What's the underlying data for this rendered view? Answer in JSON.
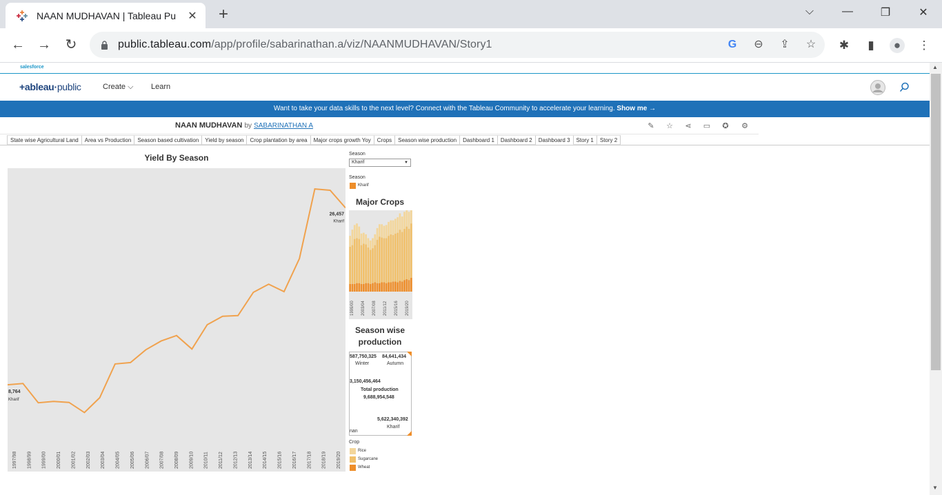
{
  "browser": {
    "tab_title": "NAAN MUDHAVAN | Tableau Pu",
    "url_host": "public.tableau.com",
    "url_path": "/app/profile/sabarinathan.a/viz/NAANMUDHAVAN/Story1"
  },
  "salesforce": {
    "label": "salesforce"
  },
  "site": {
    "logo_main": "+ableau",
    "logo_sub": "public",
    "nav_create": "Create ⌵",
    "nav_learn": "Learn"
  },
  "banner": {
    "text": "Want to take your data skills to the next level? Connect with the Tableau Community to accelerate your learning.",
    "link": "Show me →"
  },
  "viz": {
    "title": "NAAN MUDHAVAN",
    "by": "by",
    "author": "SABARINATHAN A",
    "tabs": [
      "State wise Agricultural Land",
      "Area vs Production",
      "Season based cultivation",
      "Yield by season",
      "Crop plantation by area",
      "Major crops growth Yoy",
      "Crops",
      "Season wise production",
      "Dashboard 1",
      "Dashboard 2",
      "Dashboard 3",
      "Story 1",
      "Story 2"
    ],
    "active_tab": "Dashboard 3"
  },
  "filters": {
    "season_label": "Season",
    "season_value": "Kharif",
    "legend_label": "Season",
    "legend_item": "Kharif",
    "crop_label": "Crop",
    "crop_items": [
      "Rice",
      "Sugarcane",
      "Wheat"
    ],
    "crop_colors": [
      "#f3d69b",
      "#f1c06a",
      "#ee8e2a"
    ]
  },
  "chart_data": [
    {
      "type": "line",
      "title": "Yield By Season",
      "color": "#f0a24e",
      "x": [
        "1997/98",
        "1998/99",
        "1999/00",
        "2000/01",
        "2001/02",
        "2002/03",
        "2003/04",
        "2004/05",
        "2005/06",
        "2006/07",
        "2007/08",
        "2008/09",
        "2009/10",
        "2010/11",
        "2011/12",
        "2012/13",
        "2013/14",
        "2014/15",
        "2015/16",
        "2016/17",
        "2017/18",
        "2018/19",
        "2019/20"
      ],
      "series": [
        {
          "values": [
            8764,
            8950,
            6100,
            6300,
            6150,
            4650,
            6850,
            11850,
            12050,
            13950,
            15250,
            16050,
            14050,
            17650,
            18900,
            19000,
            22450,
            23650,
            22550,
            27450,
            37750,
            37550,
            34950
          ]
        }
      ],
      "ylim": [
        0,
        40000
      ],
      "labels": [
        {
          "value": "8,764",
          "sub": "Kharif"
        },
        {
          "value": "26,457",
          "sub": "Kharif"
        }
      ]
    },
    {
      "type": "bar",
      "title": "Major Crops",
      "x_ticks": [
        "1999/00",
        "2003/04",
        "2007/08",
        "2011/12",
        "2015/16",
        "2019/20"
      ],
      "series": [
        {
          "name": "Wheat",
          "color": "#ee8e2a",
          "values": [
            10,
            10,
            10,
            11,
            11,
            10,
            10,
            11,
            11,
            10,
            11,
            12,
            11,
            11,
            12,
            12,
            11,
            12,
            12,
            13,
            13,
            12,
            14,
            13,
            15,
            16,
            15,
            18
          ]
        },
        {
          "name": "Sugarcane",
          "color": "#f1c06a",
          "values": [
            48,
            50,
            58,
            58,
            57,
            50,
            52,
            50,
            46,
            44,
            45,
            48,
            56,
            60,
            58,
            57,
            58,
            60,
            62,
            60,
            62,
            64,
            66,
            64,
            66,
            68,
            66,
            70
          ]
        },
        {
          "name": "Rice",
          "color": "#f3d69b",
          "values": [
            14,
            20,
            18,
            19,
            16,
            15,
            14,
            13,
            12,
            12,
            13,
            14,
            15,
            16,
            17,
            16,
            17,
            18,
            18,
            19,
            19,
            20,
            21,
            20,
            22,
            22,
            22,
            23
          ]
        }
      ]
    },
    {
      "type": "pie",
      "title": "Season wise production",
      "center_label": "Total production",
      "total": "9,688,954,548",
      "slices": [
        {
          "label": "Winter",
          "value": "587,750,325"
        },
        {
          "label": "Autumn",
          "value": "84,641,434"
        },
        {
          "label": "",
          "value": "3,150,456,464"
        },
        {
          "label": "Kharif",
          "value": "5,622,340,392"
        },
        {
          "label": "nan",
          "value": ""
        }
      ]
    }
  ]
}
